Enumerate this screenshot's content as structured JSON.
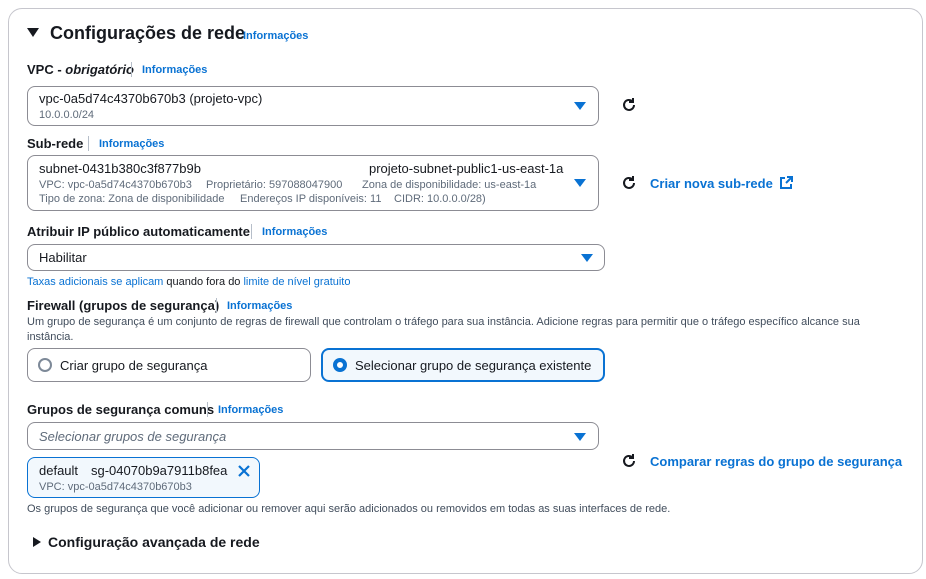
{
  "section": {
    "title": "Configurações de rede",
    "info_link": "Informações",
    "advanced_title": "Configuração avançada de rede"
  },
  "vpc": {
    "label": "VPC - ",
    "label_required": "obrigatório",
    "info_link": "Informações",
    "value": "vpc-0a5d74c4370b670b3 (projeto-vpc)",
    "cidr": "10.0.0.0/24"
  },
  "subnet": {
    "label": "Sub-rede",
    "info_link": "Informações",
    "id": "subnet-0431b380c3f877b9b",
    "name": "projeto-subnet-public1-us-east-1a",
    "vpc_line": "VPC: vpc-0a5d74c4370b670b3",
    "owner_line": "Proprietário: 597088047900",
    "zone_line": "Zona de disponibilidade: us-east-1a",
    "zone_type_line": "Tipo de zona: Zona de disponibilidade",
    "ips_line": "Endereços IP disponíveis: 11",
    "cidr_line": "CIDR: 10.0.0.0/28)",
    "create_link": "Criar nova sub-rede"
  },
  "public_ip": {
    "label": "Atribuir IP público automaticamente",
    "info_link": "Informações",
    "value": "Habilitar",
    "note_link1": "Taxas adicionais se aplicam",
    "note_mid": " quando fora do ",
    "note_link2": "limite de nível gratuito"
  },
  "firewall": {
    "label": "Firewall (grupos de segurança)",
    "info_link": "Informações",
    "description": "Um grupo de segurança é um conjunto de regras de firewall que controlam o tráfego para sua instância. Adicione regras para permitir que o tráfego específico alcance sua",
    "description2": "instância.",
    "option_create": "Criar grupo de segurança",
    "option_select": "Selecionar grupo de segurança existente",
    "selected": "Selecionar grupo de segurança existente"
  },
  "common_sg": {
    "label": "Grupos de segurança comuns",
    "info_link": "Informações",
    "placeholder": "Selecionar grupos de segurança",
    "token_name": "default",
    "token_id": "sg-04070b9a7911b8fea",
    "token_vpc": "VPC: vpc-0a5d74c4370b670b3",
    "compare_link": "Comparar regras do grupo de segurança",
    "footer": "Os grupos de segurança que você adicionar ou remover aqui serão adicionados ou removidos em todas as suas interfaces de rede."
  },
  "colors": {
    "accent": "#0972d3",
    "text": "#16191f",
    "muted": "#5f6b7a",
    "border": "#8c8c94",
    "selected_bg": "#f2f8fd"
  }
}
